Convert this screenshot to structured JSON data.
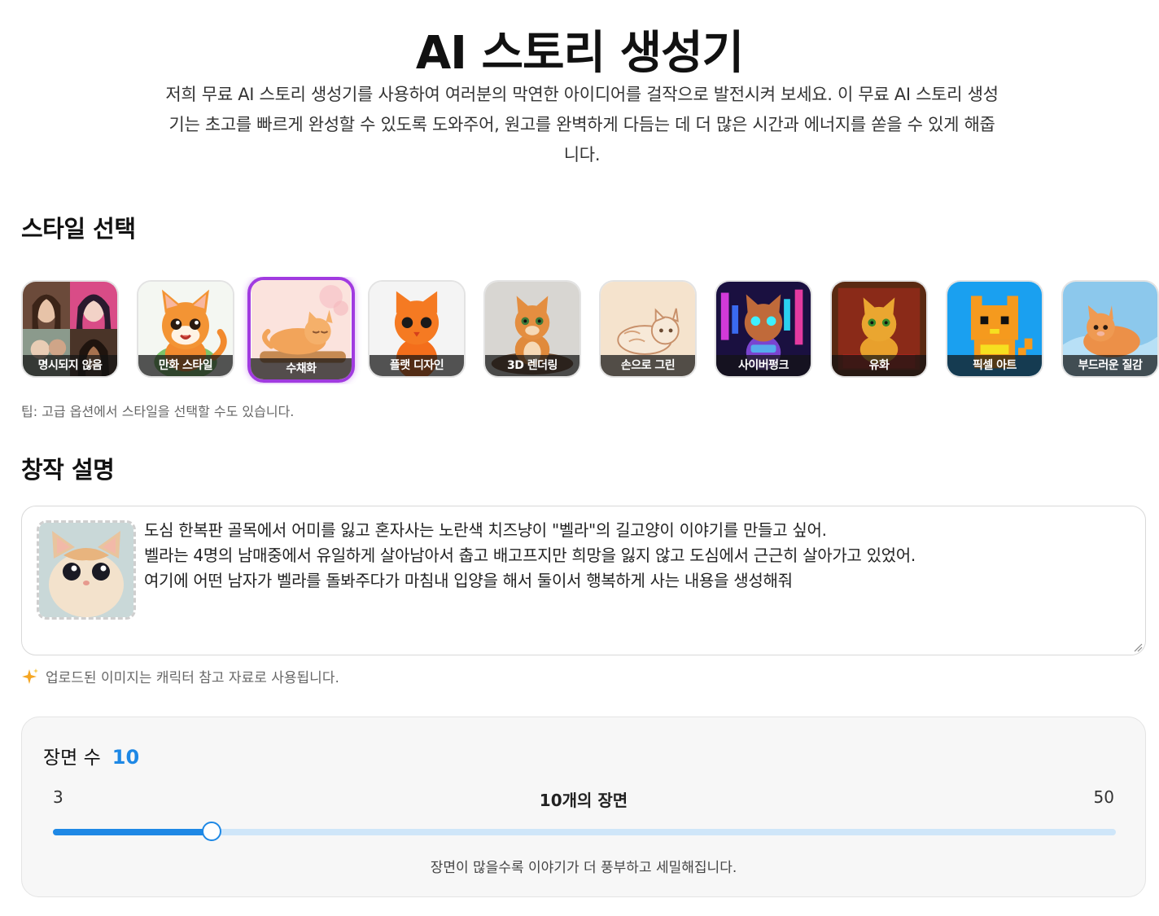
{
  "header": {
    "title": "AI 스토리 생성기",
    "description": "저희 무료 AI 스토리 생성기를 사용하여 여러분의 막연한 아이디어를 걸작으로 발전시켜 보세요. 이 무료 AI 스토리 생성기는 초고를 빠르게 완성할 수 있도록 도와주어, 원고를 완벽하게 다듬는 데 더 많은 시간과 에너지를 쏟을 수 있게 해줍니다."
  },
  "style_section": {
    "heading": "스타일 선택",
    "selected_index": 2,
    "tip": "팁: 고급 옵션에서 스타일을 선택할 수도 있습니다.",
    "styles": [
      {
        "label": "명시되지 않음",
        "icon": "portrait-collage-thumbnail"
      },
      {
        "label": "만화 스타일",
        "icon": "cartoon-cat-thumbnail"
      },
      {
        "label": "수채화",
        "icon": "watercolor-cat-thumbnail"
      },
      {
        "label": "플랫 디자인",
        "icon": "flat-cat-thumbnail"
      },
      {
        "label": "3D 렌더링",
        "icon": "3d-cat-thumbnail"
      },
      {
        "label": "손으로 그린",
        "icon": "sketch-cat-thumbnail"
      },
      {
        "label": "사이버펑크",
        "icon": "cyberpunk-cat-thumbnail"
      },
      {
        "label": "유화",
        "icon": "oil-painting-cat-thumbnail"
      },
      {
        "label": "픽셀 아트",
        "icon": "pixel-cat-thumbnail"
      },
      {
        "label": "부드러운 질감",
        "icon": "plush-cat-thumbnail"
      }
    ]
  },
  "description_section": {
    "heading": "창작 설명",
    "prompt_lines": [
      "도심 한복판 골목에서 어미를 잃고 혼자사는 노란색 치즈냥이 \"벨라\"의 길고양이 이야기를 만들고 싶어.",
      "벨라는 4명의 남매중에서 유일하게 살아남아서 춥고 배고프지만 희망을 잃지 않고 도심에서 근근히 살아가고 있었어.",
      "여기에 어떤 남자가 벨라를 돌봐주다가 마침내 입양을 해서 둘이서 행복하게 사는 내용을 생성해줘"
    ],
    "upload_note": "업로드된 이미지는 캐릭터 참고 자료로 사용됩니다."
  },
  "scene_count": {
    "label": "장면 수",
    "value": 10,
    "value_text": "10",
    "min": 3,
    "min_text": "3",
    "max": 50,
    "max_text": "50",
    "current_text": "10개의 장면",
    "hint": "장면이 많을수록 이야기가 더 풍부하고 세밀해집니다."
  },
  "colors": {
    "accent_blue": "#1e88e5",
    "selected_border": "#a13be0"
  }
}
